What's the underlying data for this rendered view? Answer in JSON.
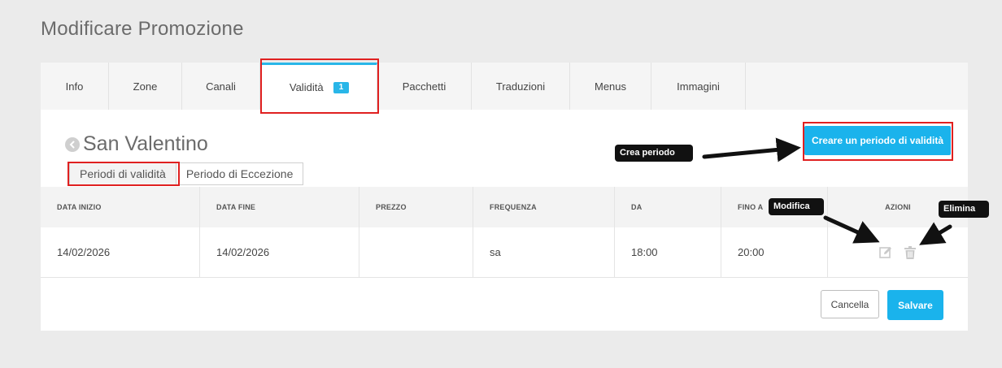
{
  "page": {
    "title": "Modificare Promozione"
  },
  "tabs": [
    {
      "label": "Info"
    },
    {
      "label": "Zone"
    },
    {
      "label": "Canali"
    },
    {
      "label": "Validità",
      "badge": "1"
    },
    {
      "label": "Pacchetti"
    },
    {
      "label": "Traduzioni"
    },
    {
      "label": "Menus"
    },
    {
      "label": "Immagini"
    }
  ],
  "promotion": {
    "name": "San Valentino"
  },
  "subtabs": [
    {
      "label": "Periodi di validità"
    },
    {
      "label": "Periodo di Eccezione"
    }
  ],
  "create_button": {
    "label": "Creare un periodo di validità"
  },
  "table": {
    "headers": [
      "DATA INIZIO",
      "DATA FINE",
      "PREZZO",
      "FREQUENZA",
      "DA",
      "FINO A",
      "AZIONI"
    ],
    "rows": [
      {
        "data_inizio": "14/02/2026",
        "data_fine": "14/02/2026",
        "prezzo": "",
        "frequenza": "sa",
        "da": "18:00",
        "fino_a": "20:00"
      }
    ]
  },
  "footer": {
    "cancel_label": "Cancella",
    "save_label": "Salvare"
  },
  "annotations": {
    "crea_periodo": "Crea periodo",
    "modifica": "Modifica",
    "elimina": "Elimina"
  },
  "colors": {
    "accent": "#1ab3ec",
    "highlight": "#e02020",
    "callout_bg": "#111111"
  },
  "icons": {
    "back": "chevron-left-circle-icon",
    "edit": "edit-icon",
    "delete": "trash-icon"
  }
}
